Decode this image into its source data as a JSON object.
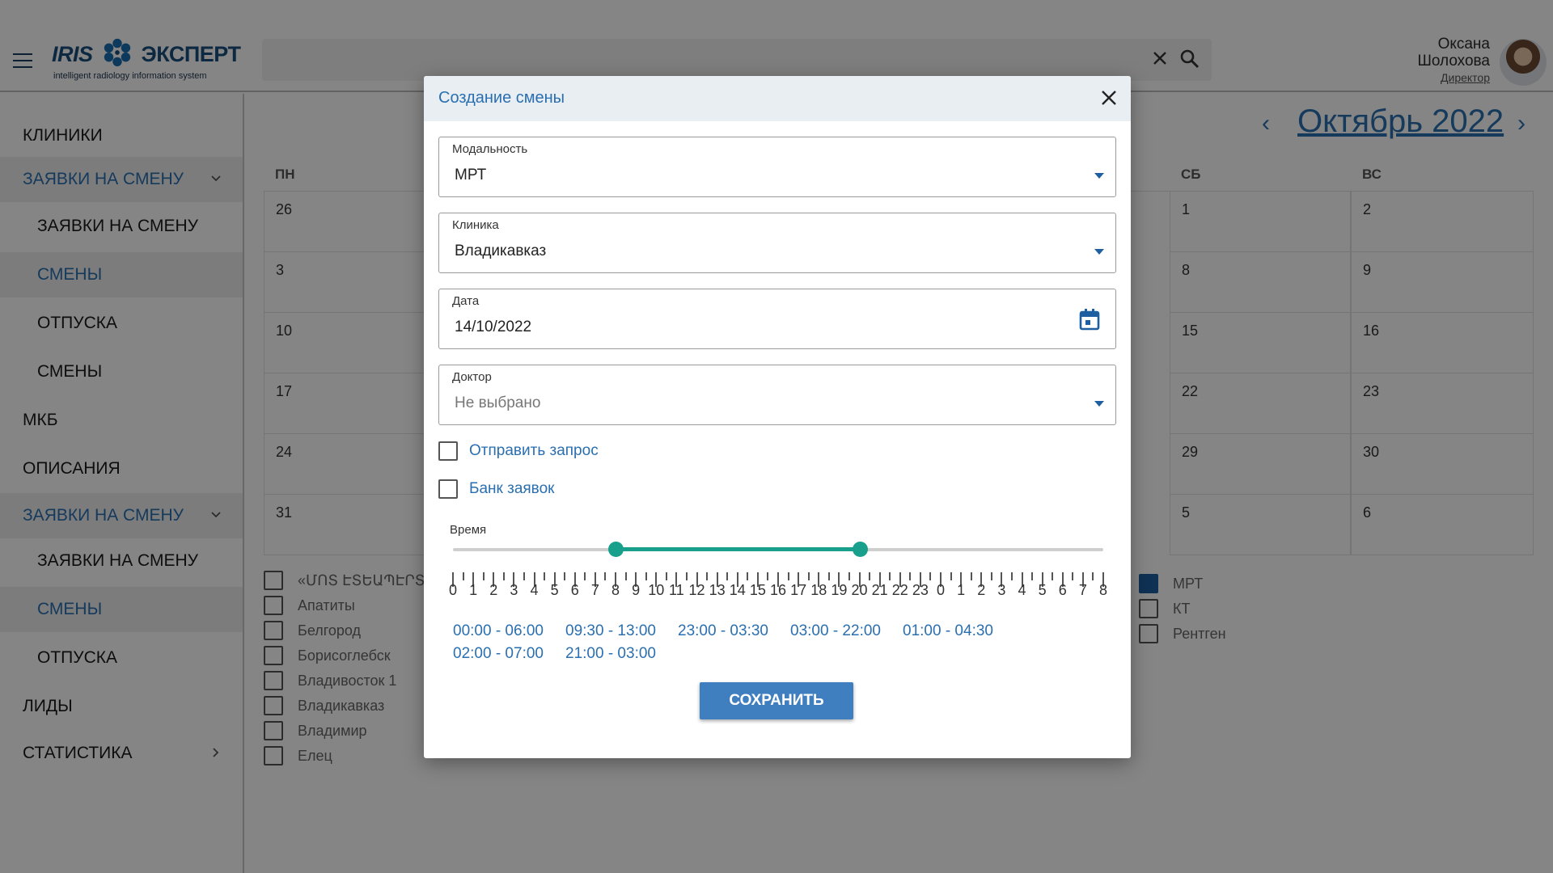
{
  "header": {
    "logo_brand": "IRIS ЭКСПЕРТ",
    "logo_tagline": "intelligent radiology information system",
    "search_value": "",
    "user_first_name": "Оксана",
    "user_last_name": "Шолохова",
    "user_role": "Директор"
  },
  "sidebar": {
    "items": [
      {
        "label": "КЛИНИКИ",
        "level": 1,
        "active": false,
        "expand": "none"
      },
      {
        "label": "ЗАЯВКИ НА СМЕНУ",
        "level": 1,
        "active": true,
        "expand": "down"
      },
      {
        "label": "ЗАЯВКИ НА СМЕНУ",
        "level": 2,
        "active": false,
        "expand": "none"
      },
      {
        "label": "СМЕНЫ",
        "level": 2,
        "active": true,
        "expand": "none"
      },
      {
        "label": "ОТПУСКА",
        "level": 2,
        "active": false,
        "expand": "none"
      },
      {
        "label": "СМЕНЫ",
        "level": 2,
        "active": false,
        "expand": "none"
      },
      {
        "label": "МКБ",
        "level": 1,
        "active": false,
        "expand": "none"
      },
      {
        "label": "ОПИСАНИЯ",
        "level": 1,
        "active": false,
        "expand": "none"
      },
      {
        "label": "ЗАЯВКИ НА СМЕНУ",
        "level": 1,
        "active": true,
        "expand": "down"
      },
      {
        "label": "ЗАЯВКИ НА СМЕНУ",
        "level": 2,
        "active": false,
        "expand": "none"
      },
      {
        "label": "СМЕНЫ",
        "level": 2,
        "active": true,
        "expand": "none"
      },
      {
        "label": "ОТПУСКА",
        "level": 2,
        "active": false,
        "expand": "none"
      },
      {
        "label": "ЛИДЫ",
        "level": 1,
        "active": false,
        "expand": "none"
      },
      {
        "label": "СТАТИСТИКА",
        "level": 1,
        "active": false,
        "expand": "right"
      }
    ]
  },
  "calendar": {
    "month_title": "Октябрь 2022",
    "day_headers": [
      "ПН",
      "СБ",
      "ВС"
    ],
    "weeks": [
      {
        "mon": "26",
        "sat": "1",
        "sun": "2"
      },
      {
        "mon": "3",
        "sat": "8",
        "sun": "9"
      },
      {
        "mon": "10",
        "sat": "15",
        "sun": "16"
      },
      {
        "mon": "17",
        "sat": "22",
        "sun": "23"
      },
      {
        "mon": "24",
        "sat": "29",
        "sun": "30"
      },
      {
        "mon": "31",
        "sat": "5",
        "sun": "6"
      }
    ],
    "clinic_filters": [
      "«ՄՈՏ ԷՏԵԱՊԷՐՏ",
      "Апатиты",
      "Белгород",
      "Борисоглебск",
      "Владивосток 1",
      "Владикавказ",
      "Владимир",
      "Елец"
    ],
    "modality_filters": [
      {
        "label": "МРТ",
        "checked": true
      },
      {
        "label": "КТ",
        "checked": false
      },
      {
        "label": "Рентген",
        "checked": false
      }
    ]
  },
  "modal": {
    "title": "Создание смены",
    "modality": {
      "label": "Модальность",
      "value": "МРТ"
    },
    "clinic": {
      "label": "Клиника",
      "value": "Владикавказ"
    },
    "date": {
      "label": "Дата",
      "value": "14/10/2022"
    },
    "doctor": {
      "label": "Доктор",
      "value": "Не выбрано"
    },
    "send_request": {
      "label": "Отправить запрос",
      "checked": false
    },
    "request_bank": {
      "label": "Банк заявок",
      "checked": false
    },
    "time": {
      "label": "Время",
      "range_start": 8,
      "range_end": 20,
      "scale_labels": [
        "0",
        "1",
        "2",
        "3",
        "4",
        "5",
        "6",
        "7",
        "8",
        "9",
        "10",
        "11",
        "12",
        "13",
        "14",
        "15",
        "16",
        "17",
        "18",
        "19",
        "20",
        "21",
        "22",
        "23",
        "0",
        "1",
        "2",
        "3",
        "4",
        "5",
        "6",
        "7",
        "8"
      ],
      "presets": [
        "00:00 - 06:00",
        "09:30 - 13:00",
        "23:00 - 03:30",
        "03:00 - 22:00",
        "01:00 - 04:30",
        "02:00 - 07:00",
        "21:00 - 03:00"
      ]
    },
    "save_label": "СОХРАНИТЬ"
  },
  "colors": {
    "accent": "#2a6fb0",
    "slider": "#18a08c",
    "button": "#3f7fbf"
  }
}
